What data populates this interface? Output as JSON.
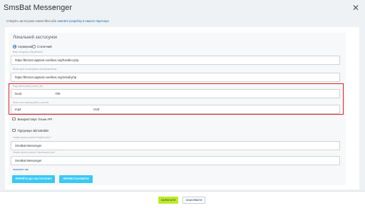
{
  "header": {
    "title": "SmsBat Messenger",
    "info_prefix": "Створіть застосунок самостійно або ",
    "info_link": "замовте розробку в нашого партнера"
  },
  "app_section": {
    "title": "Локальний застосунок",
    "radio_server": "Серверний",
    "radio_static": "Статичний",
    "handler_label": "Ваш хендлер обробника*",
    "handler_value": "https://btrix24-apptest.noelikos.org/handler.php",
    "install_label": "Шлях для початкового встановлення",
    "install_value": "https://btrix24-apptest.noelikos.org/install.php",
    "client_id_label": "Код застосунку (client_id)",
    "client_id_prefix": "local.",
    "client_id_suffix": ".700",
    "secret_label": "Ключ застосунку(client_secret)",
    "secret_prefix": "mq4",
    "secret_suffix": "UVd",
    "only_api": "Використовує тільки API",
    "bitrixmobile": "Підтримує BitrixMobile",
    "menu_en_label": "Назва пункту меню English (en) *",
    "menu_en_value": "SmsBat Messenger",
    "menu_ua_label": "Назва пункту меню Українська (ua) *",
    "menu_ua_value": "SmsBat Messenger",
    "show_all": "показати ще",
    "go_to_app": "ПЕРЕЙТИ ДО ЗАСТОСУНКУ",
    "reinstall": "ПЕРЕВСТАНОВИТИ"
  },
  "footer": {
    "save": "ЗАПИСАТИ",
    "cancel": "СКАСУВАТИ"
  }
}
